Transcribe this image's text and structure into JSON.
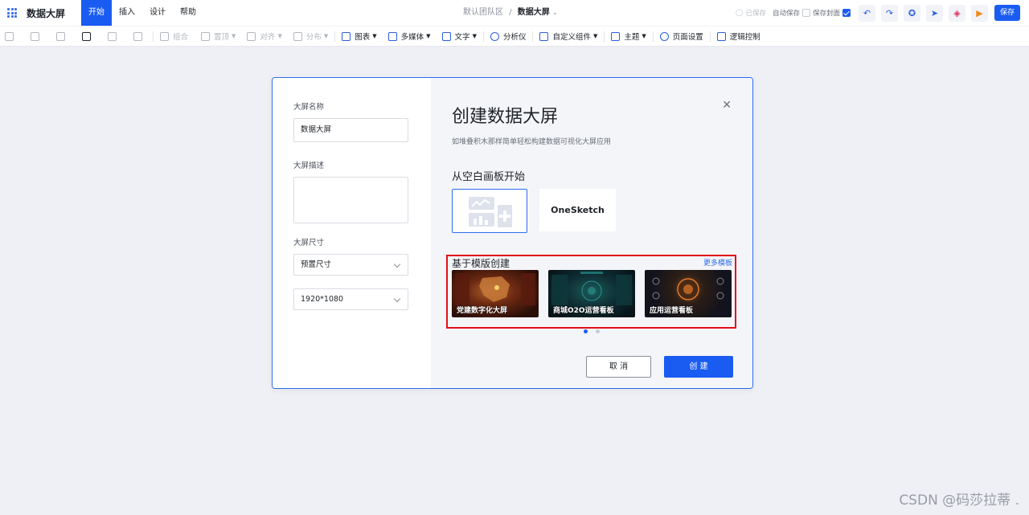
{
  "app": {
    "title": "数据大屏"
  },
  "menu": [
    {
      "label": "开始",
      "active": true
    },
    {
      "label": "插入"
    },
    {
      "label": "设计"
    },
    {
      "label": "帮助"
    }
  ],
  "breadcrumb": {
    "team": "默认团队区",
    "separator": "/",
    "current": "数据大屏"
  },
  "top_right": {
    "saved_status": "已保存",
    "auto_save": "自动保存",
    "save_cover": "保存封面",
    "save": "保存"
  },
  "toolbar": {
    "group": "组合",
    "top": "置顶",
    "align": "对齐",
    "distribute": "分布",
    "chart": "图表",
    "media": "多媒体",
    "text": "文字",
    "analyzer": "分析仪",
    "custom_component": "自定义组件",
    "theme": "主题",
    "page_settings": "页面设置",
    "logic_control": "逻辑控制"
  },
  "dialog": {
    "name_label": "大屏名称",
    "name_value": "数据大屏",
    "desc_label": "大屏描述",
    "desc_value": "",
    "size_label": "大屏尺寸",
    "size_preset": "预置尺寸",
    "size_value": "1920*1080",
    "title": "创建数据大屏",
    "subtitle": "如堆叠积木那样简单轻松构建数据可视化大屏应用",
    "blank_title": "从空白画板开始",
    "onesketch": "OneSketch",
    "template_title": "基于模版创建",
    "more_templates": "更多模板",
    "templates": [
      {
        "name": "党建数字化大屏"
      },
      {
        "name": "商城O2O运营看板"
      },
      {
        "name": "应用运营看板"
      }
    ],
    "cancel": "取 消",
    "create": "创 建"
  },
  "watermark": "CSDN @码莎拉蒂 .",
  "colors": {
    "accent": "#1a5cf1",
    "highlight": "#e0101a"
  }
}
